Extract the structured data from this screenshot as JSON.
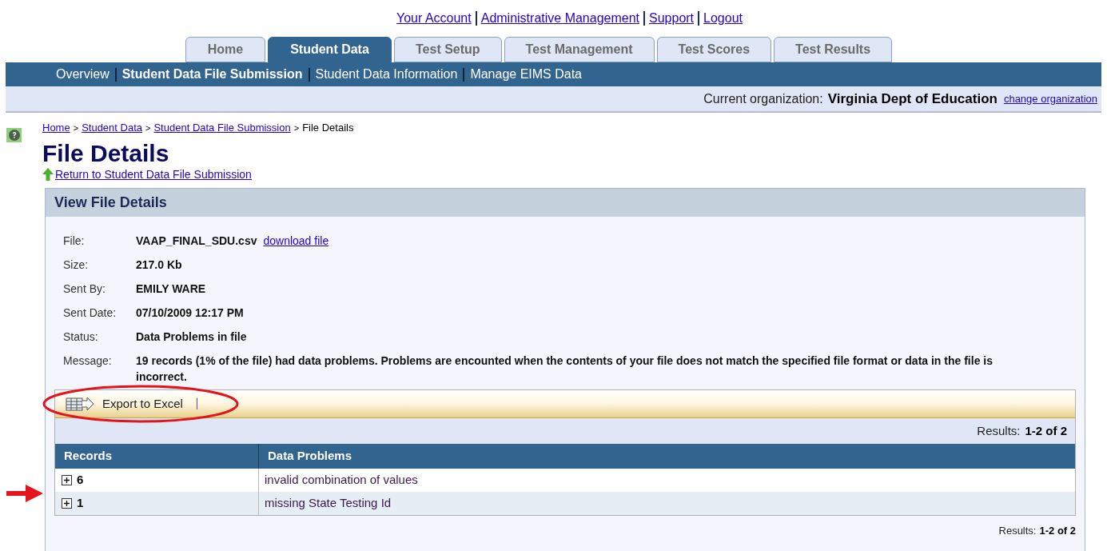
{
  "top_links": [
    "Your Account",
    "Administrative Management",
    "Support",
    "Logout"
  ],
  "tabs": [
    {
      "label": "Home",
      "selected": false
    },
    {
      "label": "Student Data",
      "selected": true
    },
    {
      "label": "Test Setup",
      "selected": false
    },
    {
      "label": "Test Management",
      "selected": false
    },
    {
      "label": "Test Scores",
      "selected": false
    },
    {
      "label": "Test Results",
      "selected": false
    }
  ],
  "subnav": [
    {
      "label": "Overview",
      "selected": false
    },
    {
      "label": "Student Data File Submission",
      "selected": true
    },
    {
      "label": "Student Data Information",
      "selected": false
    },
    {
      "label": "Manage EIMS Data",
      "selected": false
    }
  ],
  "organization": {
    "label": "Current organization:",
    "name": "Virginia Dept of Education",
    "link": "change organization"
  },
  "breadcrumbs": {
    "links": [
      "Home",
      "Student Data",
      "Student Data File Submission"
    ],
    "current": "File Details",
    "separator": ">"
  },
  "page_title": "File Details",
  "return_link": "Return to Student Data File Submission",
  "panel": {
    "title": "View File Details",
    "details": [
      {
        "label": "File:",
        "value": "VAAP_FINAL_SDU.csv",
        "link": "download file"
      },
      {
        "label": "Size:",
        "value": "217.0 Kb"
      },
      {
        "label": "Sent By:",
        "value": "EMILY WARE"
      },
      {
        "label": "Sent Date:",
        "value": "07/10/2009 12:17 PM"
      },
      {
        "label": "Status:",
        "value": "Data Problems in file"
      },
      {
        "label": "Message:",
        "value": "19 records (1% of the file) had data problems. Problems are encounted when the contents of your file does not match the specified file format or data in the file is incorrect."
      }
    ],
    "toolbar": {
      "button": "Export to Excel"
    },
    "results_top": {
      "label": "Results:",
      "range": "1-2 of 2"
    },
    "table": {
      "columns": [
        "Records",
        "Data Problems"
      ],
      "rows": [
        {
          "records": "6",
          "problem": "invalid combination of values",
          "expanded": false
        },
        {
          "records": "1",
          "problem": "missing State Testing Id",
          "expanded": false
        }
      ]
    },
    "results_bottom": {
      "label": "Results:",
      "range": "1-2 of 2"
    }
  }
}
